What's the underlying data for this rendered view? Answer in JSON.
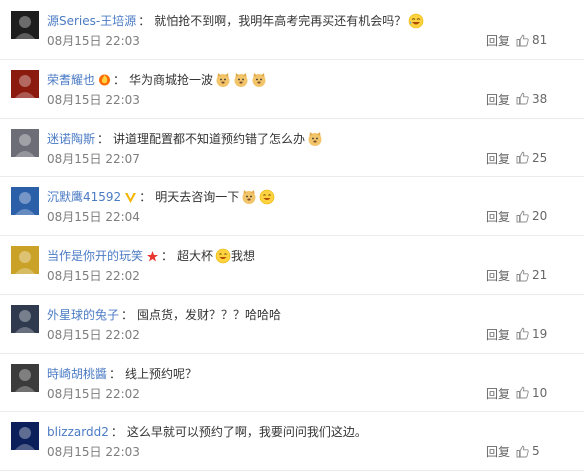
{
  "comments": [
    {
      "user": "源Series-王培源",
      "text": "就怕抢不到啊，我明年高考完再买还有机会吗？",
      "time": "08月15日 22:03",
      "reply": "回复",
      "likes": "81",
      "avatar_color": "#1e1e1e",
      "badge": "",
      "emojis": [
        "laugh-tear"
      ]
    },
    {
      "user": "荣耆耀也",
      "text": "华为商城抢一波",
      "time": "08月15日 22:03",
      "reply": "回复",
      "likes": "38",
      "avatar_color": "#8b1a0f",
      "badge": "fire",
      "emojis": [
        "doge",
        "doge",
        "doge"
      ]
    },
    {
      "user": "迷诺陶斯",
      "text": "讲道理配置都不知道预约错了怎么办",
      "time": "08月15日 22:07",
      "reply": "回复",
      "likes": "25",
      "avatar_color": "#6d6d78",
      "badge": "",
      "emojis": [
        "doge"
      ]
    },
    {
      "user": "沉默鹰41592",
      "text": "明天去咨询一下",
      "time": "08月15日 22:04",
      "reply": "回复",
      "likes": "20",
      "avatar_color": "#2b5fa8",
      "badge": "vip",
      "emojis": [
        "doge",
        "smile"
      ]
    },
    {
      "user": "当作是你开的玩笑",
      "text": "超大杯",
      "text2": "我想",
      "time": "08月15日 22:02",
      "reply": "回复",
      "likes": "21",
      "avatar_color": "#c9a227",
      "badge": "star",
      "emojis": [
        "smile"
      ]
    },
    {
      "user": "外星球的兔子",
      "text": "囤点货，发财？？？哈哈哈",
      "time": "08月15日 22:02",
      "reply": "回复",
      "likes": "19",
      "avatar_color": "#2f3a4f",
      "badge": "",
      "emojis": []
    },
    {
      "user": "時崎胡桃醬",
      "text": "线上预约呢？",
      "time": "08月15日 22:02",
      "reply": "回复",
      "likes": "10",
      "avatar_color": "#3b3b3b",
      "badge": "",
      "emojis": []
    },
    {
      "user": "blizzardd2",
      "text": "这么早就可以预约了啊，我要问问我们这边。",
      "time": "08月15日 22:03",
      "reply": "回复",
      "likes": "5",
      "avatar_color": "#0b1f5a",
      "badge": "",
      "emojis": []
    }
  ],
  "colors": {
    "username": "#4b7bc4",
    "text": "#333333",
    "meta": "#7d7d7d",
    "divider": "#ececec"
  }
}
